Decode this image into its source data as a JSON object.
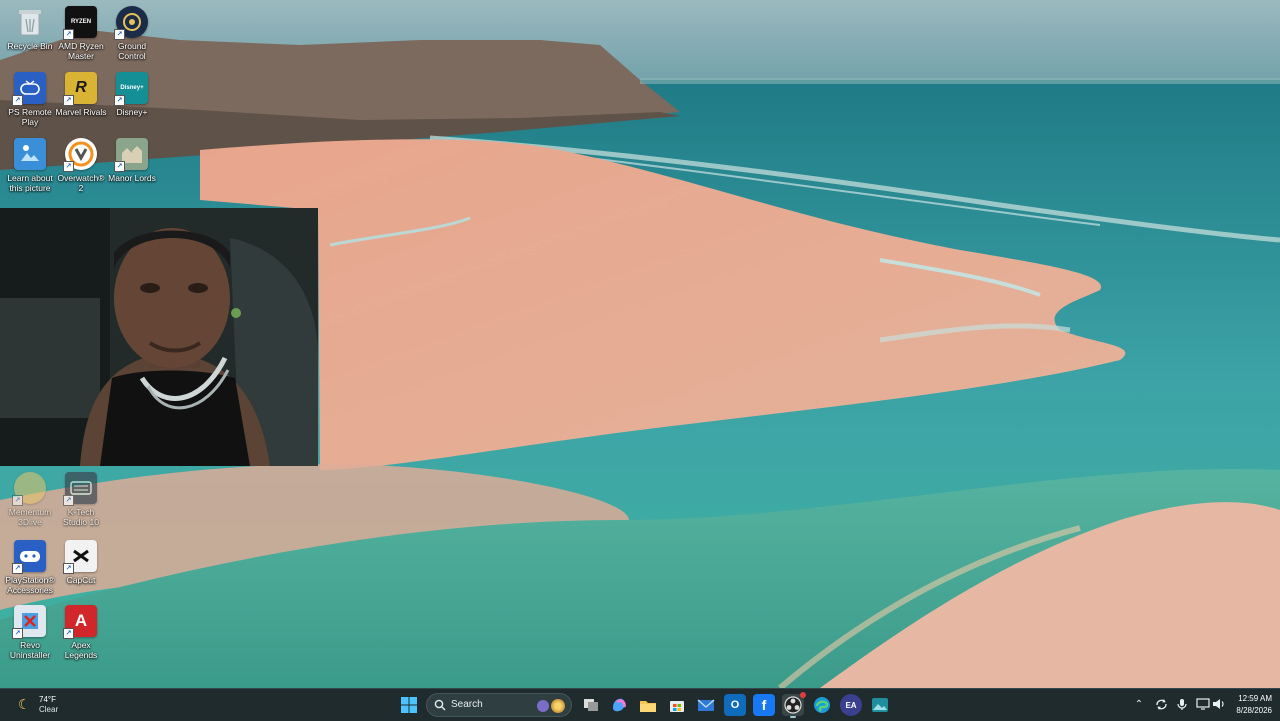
{
  "desktop": {
    "icons": [
      {
        "id": "recycle",
        "label": "Recycle Bin",
        "icon": "recycle-bin-icon"
      },
      {
        "id": "ryzen",
        "label": "AMD Ryzen Master",
        "icon": "amd-ryzen-icon",
        "glyph_text": "RYZEN"
      },
      {
        "id": "ground",
        "label": "Ground Control",
        "icon": "ground-control-icon"
      },
      {
        "id": "psremote",
        "label": "PS Remote Play",
        "icon": "ps-remote-play-icon"
      },
      {
        "id": "marvel",
        "label": "Marvel Rivals",
        "icon": "marvel-rivals-icon",
        "glyph_text": "R"
      },
      {
        "id": "disney",
        "label": "Disney+",
        "icon": "disney-plus-icon",
        "glyph_text": "Disney+"
      },
      {
        "id": "learn",
        "label": "Learn about this picture",
        "icon": "learn-about-picture-icon"
      },
      {
        "id": "overwatch",
        "label": "Overwatch® 2",
        "icon": "overwatch-icon"
      },
      {
        "id": "manor",
        "label": "Manor Lords",
        "icon": "manor-lords-icon"
      },
      {
        "id": "memento",
        "label": "Mementum 3Dlive",
        "icon": "memento-icon"
      },
      {
        "id": "kitchen",
        "label": "K-Tech Studio 10",
        "icon": "k-tech-studio-icon"
      },
      {
        "id": "psacc",
        "label": "PlayStation® Accessories",
        "icon": "playstation-accessories-icon"
      },
      {
        "id": "capcut",
        "label": "CapCut",
        "icon": "capcut-icon"
      },
      {
        "id": "revo",
        "label": "Revo Uninstaller",
        "icon": "revo-uninstaller-icon"
      },
      {
        "id": "apex",
        "label": "Apex Legends",
        "icon": "apex-legends-icon",
        "glyph_text": "A"
      }
    ]
  },
  "taskbar": {
    "weather": {
      "temp": "74°F",
      "condition": "Clear",
      "icon": "moon-icon"
    },
    "search": {
      "placeholder": "Search"
    },
    "apps": [
      {
        "name": "start-button",
        "icon": "windows-logo-icon"
      },
      {
        "name": "task-view",
        "icon": "task-view-icon"
      },
      {
        "name": "copilot",
        "icon": "copilot-icon"
      },
      {
        "name": "file-explorer",
        "icon": "folder-icon"
      },
      {
        "name": "microsoft-store",
        "icon": "store-icon"
      },
      {
        "name": "mail",
        "icon": "mail-icon"
      },
      {
        "name": "outlook",
        "icon": "outlook-icon",
        "glyph_text": "O"
      },
      {
        "name": "facebook",
        "icon": "facebook-icon",
        "glyph_text": "f"
      },
      {
        "name": "obs-studio",
        "icon": "obs-icon"
      },
      {
        "name": "edge",
        "icon": "edge-icon"
      },
      {
        "name": "ea-app",
        "icon": "ea-icon",
        "glyph_text": "EA"
      },
      {
        "name": "photos",
        "icon": "photos-icon"
      }
    ],
    "tray": [
      "chevron-up-icon",
      "sync-icon",
      "microphone-icon",
      "network-icon",
      "speaker-icon"
    ],
    "clock": {
      "time": "12:59 AM",
      "date": "8/28/2026"
    }
  },
  "colors": {
    "taskbar_bg": "#1f2b2d",
    "sand": "#e3a58c",
    "sea": "#3f9ea3"
  }
}
